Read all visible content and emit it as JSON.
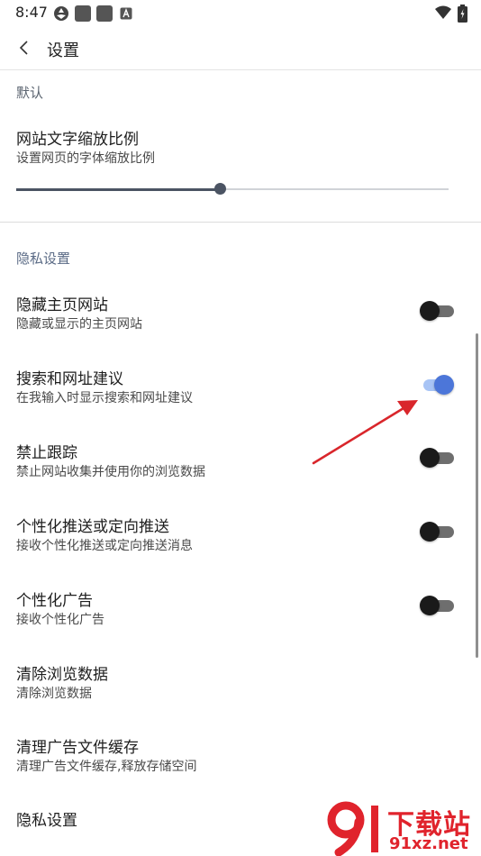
{
  "status_bar": {
    "time": "8:47",
    "left_icons": [
      "app-notification-icon",
      "square-notification-icon",
      "square-notification-icon",
      "a-notification-icon"
    ],
    "right_icons": [
      "wifi-icon",
      "battery-charging-icon"
    ]
  },
  "app_bar": {
    "back_icon": "chevron-left-icon",
    "title": "设置"
  },
  "sections": {
    "default_label": "默认",
    "privacy_label": "隐私设置"
  },
  "text_zoom": {
    "title": "网站文字缩放比例",
    "subtitle": "设置网页的字体缩放比例",
    "value_fraction": 0.47
  },
  "preferences": [
    {
      "title": "隐藏主页网站",
      "subtitle": "隐藏或显示的主页网站",
      "switch": false
    },
    {
      "title": "搜索和网址建议",
      "subtitle": "在我输入时显示搜索和网址建议",
      "switch": true
    },
    {
      "title": "禁止跟踪",
      "subtitle": "禁止网站收集并使用你的浏览数据",
      "switch": false
    },
    {
      "title": "个性化推送或定向推送",
      "subtitle": "接收个性化推送或定向推送消息",
      "switch": false
    },
    {
      "title": "个性化广告",
      "subtitle": "接收个性化广告",
      "switch": false
    },
    {
      "title": "清除浏览数据",
      "subtitle": "清除浏览数据"
    },
    {
      "title": "清理广告文件缓存",
      "subtitle": "清理广告文件缓存,释放存储空间"
    },
    {
      "title": "隐私设置"
    }
  ],
  "colors": {
    "switch_on_thumb": "#4c76d9",
    "switch_on_track": "#a8c4f5",
    "switch_off_thumb": "#1a1a1a",
    "annotation_arrow": "#d9262b",
    "watermark": "#e0232c"
  },
  "watermark": {
    "line1": "下载站",
    "line2": "91xz.net"
  }
}
